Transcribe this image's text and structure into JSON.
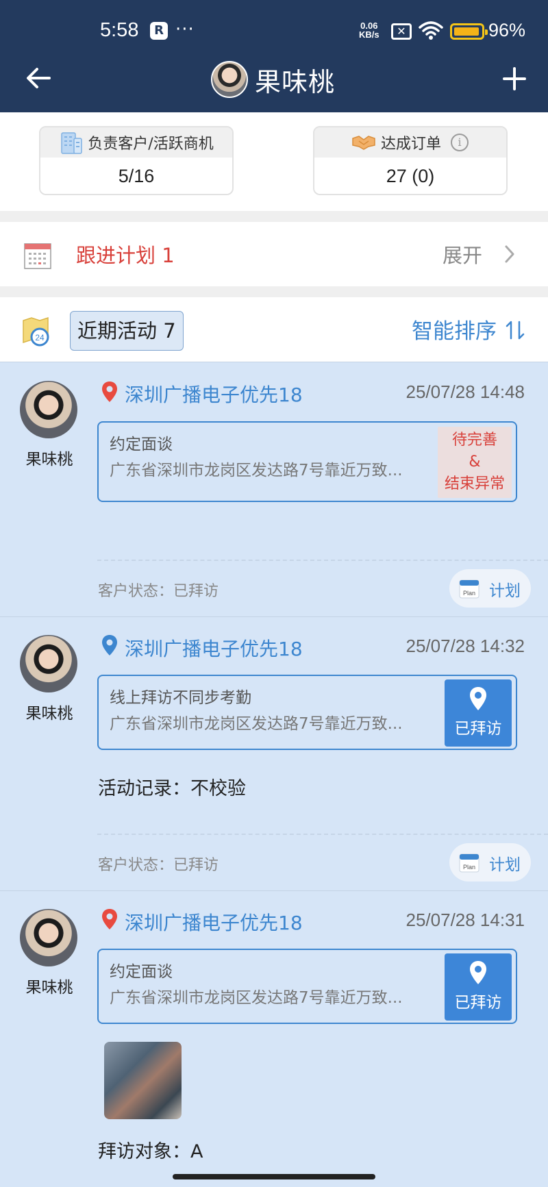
{
  "status_bar": {
    "time": "5:58",
    "app_badge": "R",
    "dots": "···",
    "net_speed_value": "0.06",
    "net_speed_unit": "KB/s",
    "battery_level": 0.96,
    "battery_text": "96%"
  },
  "header": {
    "title": "果味桃",
    "back_icon": "arrow-left-icon",
    "add_icon": "plus-icon",
    "bg_color": "#233a5e"
  },
  "stats": {
    "customers": {
      "label": "负责客户/活跃商机",
      "value": "5/16"
    },
    "orders": {
      "label": "达成订单",
      "value": "27 (0)",
      "info_glyph": "i"
    }
  },
  "follow_plan": {
    "label": "跟进计划 1",
    "expand": "展开"
  },
  "recent": {
    "label": "近期活动 7",
    "sort": "智能排序",
    "map_badge": "24"
  },
  "activities": [
    {
      "owner": "果味桃",
      "company": "深圳广播电子优先18",
      "time": "25/07/28 14:48",
      "pin_color": "#e84a3f",
      "type": "约定面谈",
      "address": "广东省深圳市龙岗区发达路7号靠近万致...",
      "badge_lines": [
        "待完善",
        "&",
        "结束异常"
      ],
      "customer_status": "客户状态：已拜访",
      "plan_label": "计划",
      "plan_icon_text": "Plan"
    },
    {
      "owner": "果味桃",
      "company": "深圳广播电子优先18",
      "time": "25/07/28 14:32",
      "pin_color": "#3d86cf",
      "type": "线上拜访不同步考勤",
      "address": "广东省深圳市龙岗区发达路7号靠近万致...",
      "visited_label": "已拜访",
      "note": "活动记录：不校验",
      "customer_status": "客户状态：已拜访",
      "plan_label": "计划",
      "plan_icon_text": "Plan"
    },
    {
      "owner": "果味桃",
      "company": "深圳广播电子优先18",
      "time": "25/07/28 14:31",
      "pin_color": "#e84a3f",
      "type": "约定面谈",
      "address": "广东省深圳市龙岗区发达路7号靠近万致...",
      "visited_label": "已拜访",
      "visit_target": "拜访对象：A"
    }
  ],
  "colors": {
    "accent_blue": "#3d86cf",
    "warn_red": "#d8403a",
    "card_bg": "#d6e5f7"
  }
}
